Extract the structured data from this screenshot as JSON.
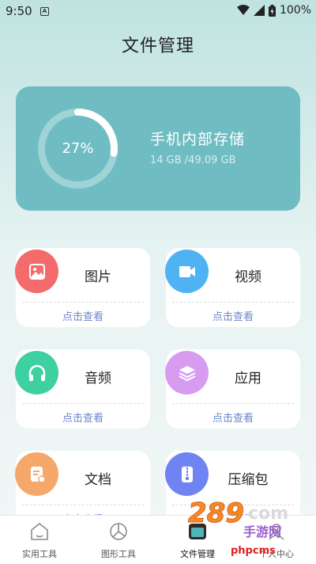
{
  "status_bar": {
    "time": "9:50",
    "app_notification_icon": "A",
    "battery_percent": "100%"
  },
  "page_title": "文件管理",
  "storage": {
    "percent_text": "27%",
    "percent_value": 0.27,
    "title": "手机内部存储",
    "size_text": "14 GB /49.09 GB"
  },
  "categories": [
    {
      "label": "图片",
      "link": "点击查看",
      "icon": "image-icon",
      "color": "#f36b6b"
    },
    {
      "label": "视频",
      "link": "点击查看",
      "icon": "video-icon",
      "color": "#4fb3f3"
    },
    {
      "label": "音频",
      "link": "点击查看",
      "icon": "headphones-icon",
      "color": "#3ed0a1"
    },
    {
      "label": "应用",
      "link": "点击查看",
      "icon": "layers-icon",
      "color": "#d79cf0"
    },
    {
      "label": "文档",
      "link": "点击查看",
      "icon": "document-icon",
      "color": "#f5a86a"
    },
    {
      "label": "压缩包",
      "link": "点击查看",
      "icon": "zip-icon",
      "color": "#6f84f2"
    }
  ],
  "bottom_nav": [
    {
      "label": "实用工具",
      "icon": "home-icon"
    },
    {
      "label": "图形工具",
      "icon": "pie-chart-icon"
    },
    {
      "label": "文件管理",
      "icon": "folder-icon",
      "active": true
    },
    {
      "label": "个人中心",
      "icon": "person-icon"
    }
  ],
  "watermark": {
    "brand": "289",
    "suffix": "com",
    "sub": "手游网",
    "site": "phpcms"
  }
}
